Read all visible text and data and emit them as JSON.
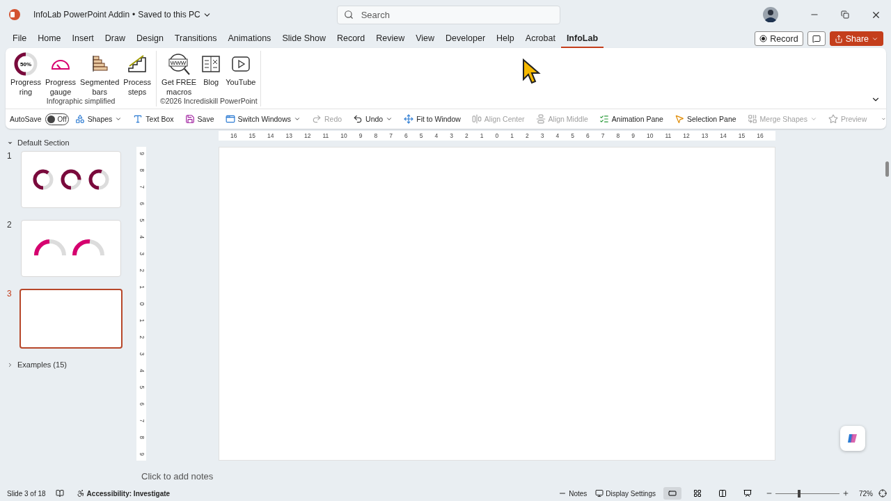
{
  "app": {
    "title": "InfoLab PowerPoint Addin",
    "separator": "•",
    "save_status": "Saved to this PC",
    "search": {
      "placeholder": "Search"
    }
  },
  "menu_tabs": [
    {
      "label": "File",
      "selected": false
    },
    {
      "label": "Home",
      "selected": false
    },
    {
      "label": "Insert",
      "selected": false
    },
    {
      "label": "Draw",
      "selected": false
    },
    {
      "label": "Design",
      "selected": false
    },
    {
      "label": "Transitions",
      "selected": false
    },
    {
      "label": "Animations",
      "selected": false
    },
    {
      "label": "Slide Show",
      "selected": false
    },
    {
      "label": "Record",
      "selected": false
    },
    {
      "label": "Review",
      "selected": false
    },
    {
      "label": "View",
      "selected": false
    },
    {
      "label": "Developer",
      "selected": false
    },
    {
      "label": "Help",
      "selected": false
    },
    {
      "label": "Acrobat",
      "selected": false
    },
    {
      "label": "InfoLab",
      "selected": true
    }
  ],
  "header_buttons": {
    "record": "Record",
    "share": "Share"
  },
  "ribbon_groups": [
    {
      "label": "Infographic simplified",
      "buttons": [
        {
          "kind": "ring",
          "badge": "50%",
          "label_lines": [
            "Progress",
            "ring"
          ]
        },
        {
          "kind": "gauge",
          "label_lines": [
            "Progress",
            "gauge"
          ]
        },
        {
          "kind": "bars",
          "label_lines": [
            "Segmented",
            "bars"
          ]
        },
        {
          "kind": "steps",
          "label_lines": [
            "Process",
            "steps"
          ]
        }
      ]
    },
    {
      "label": "©2026 Incrediskill PowerPoint",
      "buttons": [
        {
          "kind": "www",
          "badge": "WWW",
          "label_lines": [
            "Get FREE",
            "macros"
          ]
        },
        {
          "kind": "blog",
          "label_lines": [
            "Blog"
          ]
        },
        {
          "kind": "youtube",
          "label_lines": [
            "YouTube"
          ]
        }
      ]
    }
  ],
  "quick_access": [
    {
      "kind": "autosave",
      "label": "AutoSave",
      "toggle_label": "Off",
      "on": false
    },
    {
      "kind": "shapes",
      "label": "Shapes",
      "dropdown": true,
      "disabled": false
    },
    {
      "kind": "textbox",
      "label": "Text Box",
      "dropdown": false,
      "disabled": false
    },
    {
      "kind": "save",
      "label": "Save",
      "dropdown": false,
      "disabled": false
    },
    {
      "kind": "switch",
      "label": "Switch Windows",
      "dropdown": true,
      "disabled": false
    },
    {
      "kind": "redo",
      "label": "Redo",
      "dropdown": false,
      "disabled": true
    },
    {
      "kind": "undo",
      "label": "Undo",
      "dropdown": true,
      "disabled": false
    },
    {
      "kind": "fit",
      "label": "Fit to Window",
      "dropdown": false,
      "disabled": false
    },
    {
      "kind": "align-center",
      "label": "Align Center",
      "dropdown": false,
      "disabled": true
    },
    {
      "kind": "align-middle",
      "label": "Align Middle",
      "dropdown": false,
      "disabled": true
    },
    {
      "kind": "animation",
      "label": "Animation Pane",
      "dropdown": false,
      "disabled": false
    },
    {
      "kind": "selection",
      "label": "Selection Pane",
      "dropdown": false,
      "disabled": false
    },
    {
      "kind": "merge",
      "label": "Merge Shapes",
      "dropdown": true,
      "disabled": true
    },
    {
      "kind": "preview",
      "label": "Preview",
      "dropdown": false,
      "disabled": true
    }
  ],
  "sections": [
    {
      "label": "Default Section",
      "expanded": true,
      "slides": [
        {
          "number": "1",
          "kind": "rings",
          "selected": false
        },
        {
          "number": "2",
          "kind": "gauges",
          "selected": false
        },
        {
          "number": "3",
          "kind": "blank",
          "selected": true
        }
      ]
    },
    {
      "label": "Examples (15)",
      "expanded": false
    }
  ],
  "horizontal_ruler": [
    "16",
    "15",
    "14",
    "13",
    "12",
    "11",
    "10",
    "9",
    "8",
    "7",
    "6",
    "5",
    "4",
    "3",
    "2",
    "1",
    "0",
    "1",
    "2",
    "3",
    "4",
    "5",
    "6",
    "7",
    "8",
    "9",
    "10",
    "11",
    "12",
    "13",
    "14",
    "15",
    "16"
  ],
  "vertical_ruler": [
    "9",
    "8",
    "7",
    "6",
    "5",
    "4",
    "3",
    "2",
    "1",
    "0",
    "1",
    "2",
    "3",
    "4",
    "5",
    "6",
    "7",
    "8",
    "9"
  ],
  "notes": {
    "placeholder": "Click to add notes"
  },
  "status_bar": {
    "slide_info": "Slide 3 of 18",
    "accessibility": "Accessibility: Investigate",
    "notes": "Notes",
    "display": "Display Settings",
    "views": [
      {
        "kind": "normal",
        "selected": true
      },
      {
        "kind": "sorter",
        "selected": false
      },
      {
        "kind": "reading",
        "selected": false
      },
      {
        "kind": "slideshow",
        "selected": false
      }
    ],
    "zoom": {
      "level": 0.37,
      "reading": "72%"
    }
  }
}
